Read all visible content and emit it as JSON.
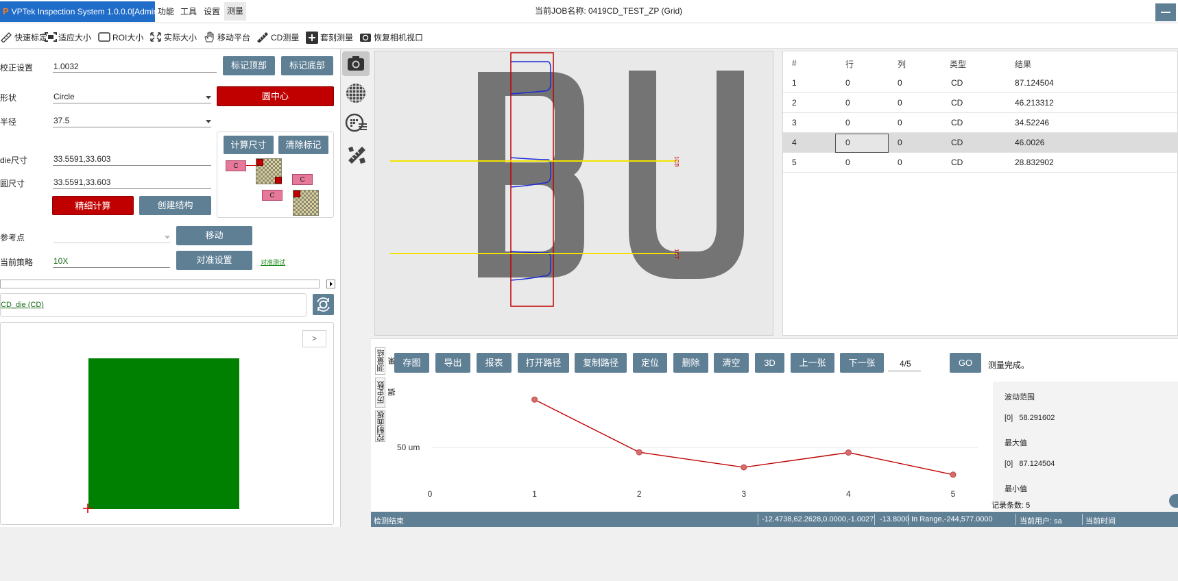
{
  "app": {
    "title": "VPTek Inspection System 1.0.0.0[Admin]",
    "logo_letter": "P",
    "menu": [
      "功能",
      "工具",
      "设置",
      "测量"
    ],
    "active_menu": "测量",
    "job_label": "当前JOB名称:  0419CD_TEST_ZP (Grid)"
  },
  "toolbar": {
    "items": [
      {
        "label": "快速标定",
        "icon": "ruler-icon"
      },
      {
        "label": "适应大小",
        "icon": "fit-icon"
      },
      {
        "label": "ROI大小",
        "icon": "roi-icon"
      },
      {
        "label": "实际大小",
        "icon": "expand-icon"
      },
      {
        "label": "移动平台",
        "icon": "hand-icon"
      },
      {
        "label": "CD测量",
        "icon": "measure-icon"
      },
      {
        "label": "套刻测量",
        "icon": "plus-icon"
      },
      {
        "label": "恢复相机视口",
        "icon": "refresh-icon"
      }
    ]
  },
  "left": {
    "calib_label": "校正设置",
    "calib_value": "1.0032",
    "mark_top": "标记顶部",
    "mark_bottom": "标记底部",
    "shape_label": "形状",
    "shape_value": "Circle",
    "circle_center": "圆中心",
    "radius_label": "半径",
    "radius_value": "37.5",
    "calc_size": "计算尺寸",
    "clear_mark": "清除标记",
    "die_size_label": "die尺寸",
    "die_size_value": "33.5591,33.603",
    "circle_size_label": "圆尺寸",
    "circle_size_value": "33.5591,33.603",
    "fine_calc": "精细计算",
    "create_struct": "创建结构",
    "ref_point_label": "参考点",
    "ref_point_value": "",
    "move": "移动",
    "strategy_label": "当前策略",
    "strategy_value": "10X",
    "align_setting": "对准设置",
    "align_test": "对准测试",
    "item_link": "CD_die (CD)",
    "nav_next": ">",
    "diagram_c": "C"
  },
  "table": {
    "headers": [
      "#",
      "行",
      "列",
      "类型",
      "结果"
    ],
    "rows": [
      [
        "1",
        "0",
        "0",
        "CD",
        "87.124504"
      ],
      [
        "2",
        "0",
        "0",
        "CD",
        "46.213312"
      ],
      [
        "3",
        "0",
        "0",
        "CD",
        "34.52246"
      ],
      [
        "4",
        "0",
        "0",
        "CD",
        "46.0026"
      ],
      [
        "5",
        "0",
        "0",
        "CD",
        "28.832902"
      ]
    ],
    "selected_row": 4
  },
  "image": {
    "letters": "BU",
    "label_1": "1CB",
    "label_2": "1CT"
  },
  "bottom": {
    "vtabs": [
      "测量结果",
      "历史数据",
      "控制面板"
    ],
    "buttons": [
      "存图",
      "导出",
      "报表",
      "打开路径",
      "复制路径",
      "定位",
      "删除",
      "清空",
      "3D",
      "上一张",
      "下一张"
    ],
    "page": "4/5",
    "go": "GO",
    "status_msg": "测量完成。",
    "stats": {
      "range_label": "波动范围",
      "range_value": "[0]   58.291602",
      "max_label": "最大值",
      "max_value": "[0]   87.124504",
      "min_label": "最小值"
    },
    "record_count": "记录条数: 5"
  },
  "chart_data": {
    "type": "line",
    "x": [
      1,
      2,
      3,
      4,
      5
    ],
    "values": [
      87.124504,
      46.213312,
      34.52246,
      46.0026,
      28.832902
    ],
    "xticks": [
      "0",
      "1",
      "2",
      "3",
      "4",
      "5"
    ],
    "xlim": [
      0,
      5
    ],
    "ylim": [
      0,
      100
    ],
    "y_gridline": 50,
    "y_gridline_label": "50 um",
    "color": "#c00000"
  },
  "status_bar": {
    "left": "检测结束",
    "coords": "-12.4738,62.2628,0.0000,-1.0027",
    "z": "-13.8000",
    "range": "In Range,-244,577.0000",
    "user": "当前用户:  sa",
    "time": "当前时间"
  },
  "colors": {
    "accent": "#5f7f95",
    "danger": "#c00000",
    "title_blue": "#1f6cc9",
    "green_die": "#008000"
  }
}
